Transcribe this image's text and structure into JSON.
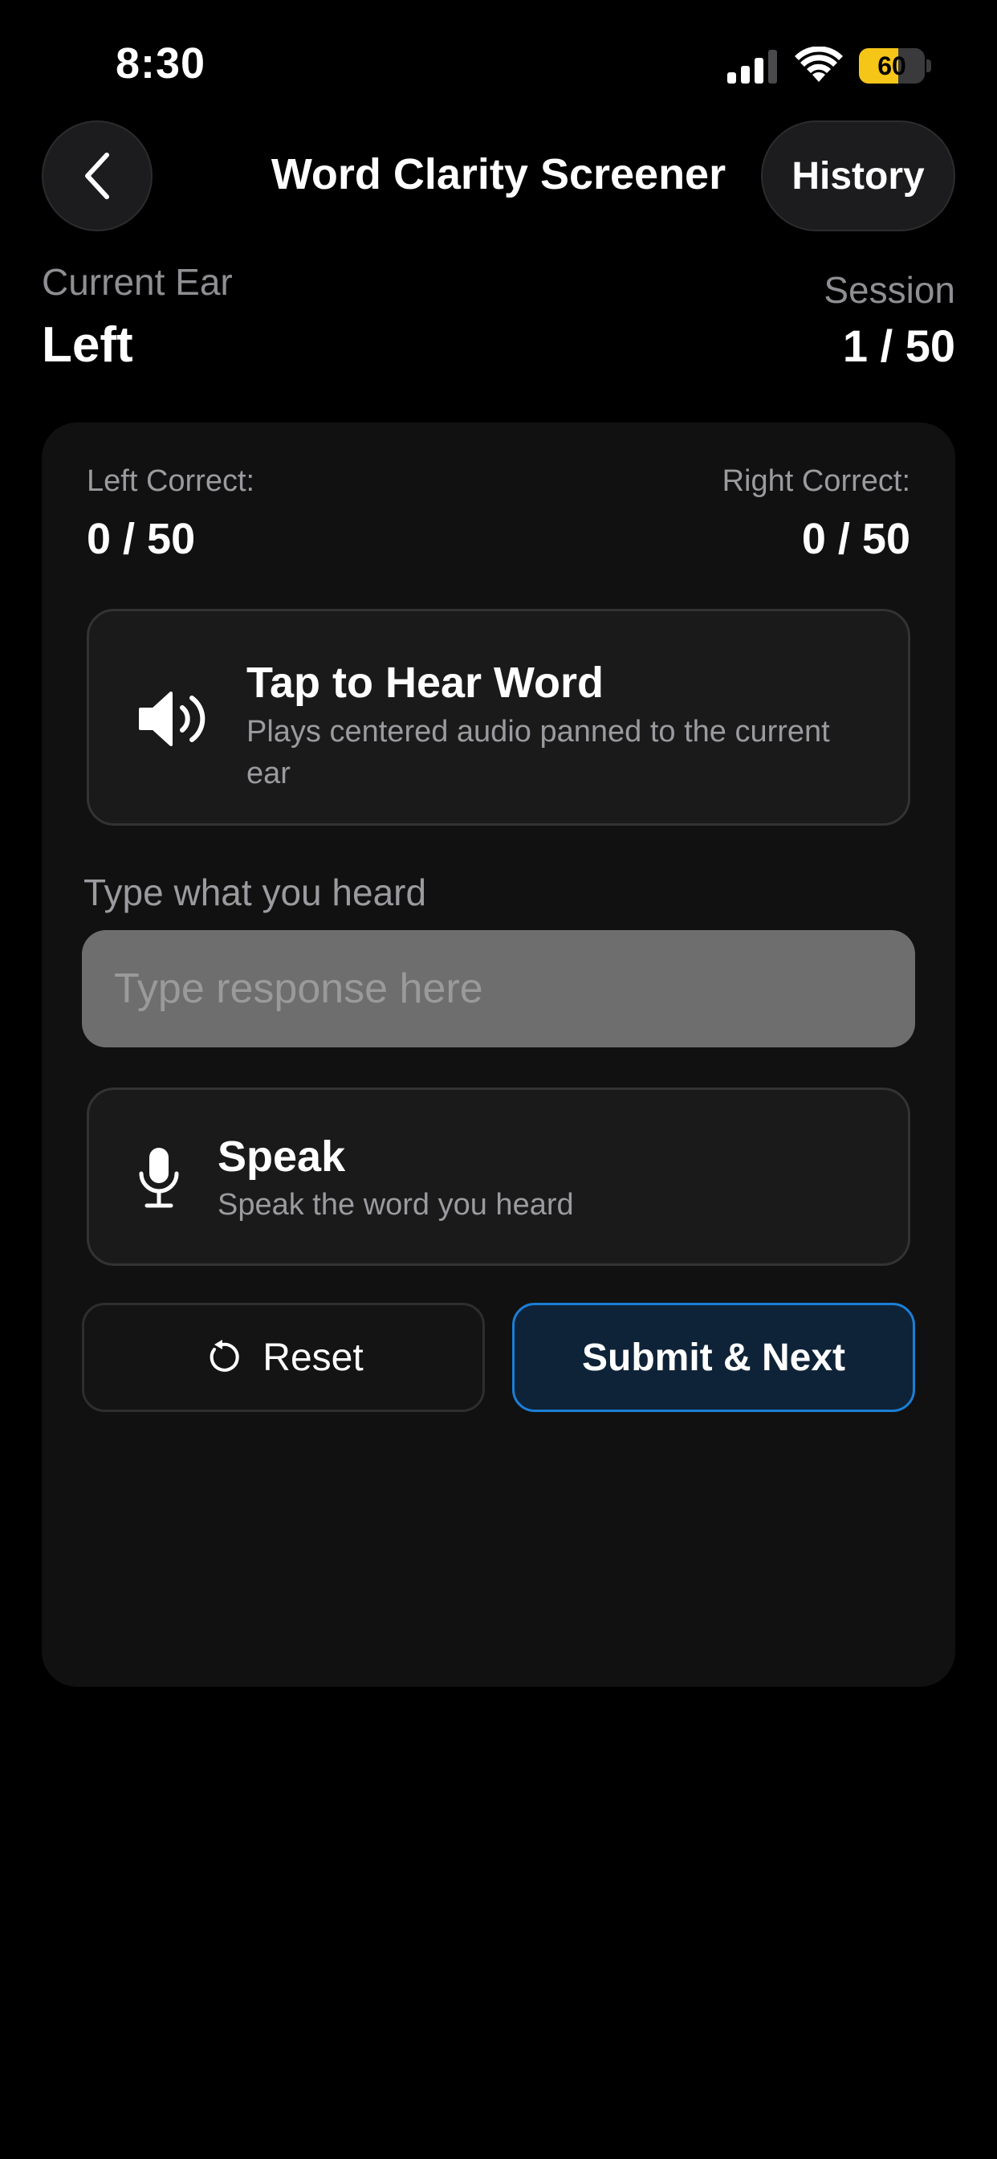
{
  "status_bar": {
    "time": "8:30",
    "battery_level": "60",
    "battery_fraction": 0.6,
    "battery_color": "#f5c518",
    "signal_bars_filled": 3,
    "signal_bars_total": 4
  },
  "nav": {
    "back_icon": "chevron-left-icon",
    "title": "Word Clarity Screener",
    "history_label": "History"
  },
  "ear": {
    "label": "Current Ear",
    "value": "Left"
  },
  "session": {
    "label": "Session",
    "value": "1 / 50"
  },
  "scores": {
    "left_label": "Left Correct:",
    "left_value": "0 / 50",
    "right_label": "Right Correct:",
    "right_value": "0 / 50"
  },
  "hear": {
    "icon": "speaker-icon",
    "title": "Tap to Hear Word",
    "subtitle": "Plays centered audio panned to the current ear"
  },
  "response": {
    "label": "Type what you heard",
    "value": "",
    "placeholder": "Type response here"
  },
  "speak": {
    "icon": "microphone-icon",
    "title": "Speak",
    "subtitle": "Speak the word you heard"
  },
  "actions": {
    "reset_icon": "reset-icon",
    "reset_label": "Reset",
    "submit_label": "Submit & Next",
    "submit_accent": "#1a7fd6"
  }
}
